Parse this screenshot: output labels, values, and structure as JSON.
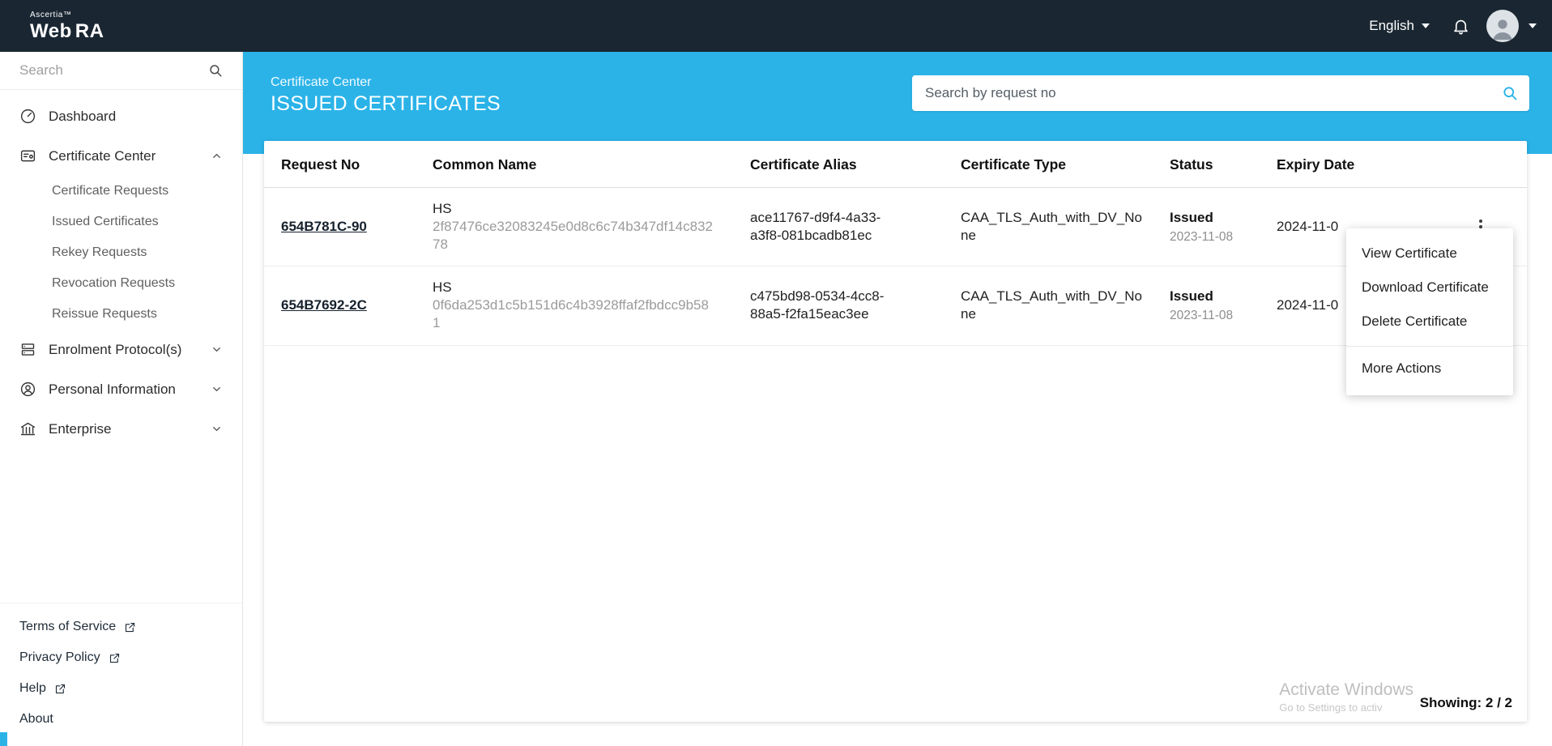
{
  "topbar": {
    "brand_small": "Ascertia™",
    "brand_web": "Web",
    "brand_ra": "RA",
    "language_label": "English",
    "icons": [
      "caret-down-icon",
      "bell-icon",
      "avatar",
      "caret-down-icon"
    ]
  },
  "sidebar": {
    "search_placeholder": "Search",
    "search_icon": "search-icon",
    "items": [
      {
        "label": "Dashboard",
        "icon": "dashboard-icon",
        "expandable": false
      },
      {
        "label": "Certificate Center",
        "icon": "certificate-center-icon",
        "expandable": true,
        "expanded": true,
        "children": [
          {
            "label": "Certificate Requests"
          },
          {
            "label": "Issued Certificates"
          },
          {
            "label": "Rekey Requests"
          },
          {
            "label": "Revocation Requests"
          },
          {
            "label": "Reissue Requests"
          }
        ]
      },
      {
        "label": "Enrolment Protocol(s)",
        "icon": "enrolment-protocols-icon",
        "expandable": true,
        "expanded": false
      },
      {
        "label": "Personal Information",
        "icon": "personal-information-icon",
        "expandable": true,
        "expanded": false
      },
      {
        "label": "Enterprise",
        "icon": "enterprise-icon",
        "expandable": true,
        "expanded": false
      }
    ],
    "footer_links": [
      {
        "label": "Terms of Service",
        "icon": "external-link-icon"
      },
      {
        "label": "Privacy Policy",
        "icon": "external-link-icon"
      },
      {
        "label": "Help",
        "icon": "external-link-icon"
      },
      {
        "label": "About",
        "icon": ""
      }
    ]
  },
  "header": {
    "breadcrumb": "Certificate Center",
    "title": "ISSUED CERTIFICATES",
    "search_placeholder": "Search by request no",
    "search_icon": "search-icon"
  },
  "table": {
    "columns": [
      "Request No",
      "Common Name",
      "Certificate Alias",
      "Certificate Type",
      "Status",
      "Expiry Date"
    ],
    "rows": [
      {
        "request_no": "654B781C-90",
        "common_name_prefix": "HS",
        "common_name_hash": "2f87476ce32083245e0d8c6c74b347df14c83278",
        "certificate_alias": "ace11767-d9f4-4a33-a3f8-081bcadb81ec",
        "certificate_type": "CAA_TLS_Auth_with_DV_None",
        "status": "Issued",
        "status_date": "2023-11-08",
        "expiry_date": "2024-11-0"
      },
      {
        "request_no": "654B7692-2C",
        "common_name_prefix": "HS",
        "common_name_hash": "0f6da253d1c5b151d6c4b3928ffaf2fbdcc9b581",
        "certificate_alias": "c475bd98-0534-4cc8-88a5-f2fa15eac3ee",
        "certificate_type": "CAA_TLS_Auth_with_DV_None",
        "status": "Issued",
        "status_date": "2023-11-08",
        "expiry_date": "2024-11-0"
      }
    ],
    "showing": "Showing: 2 / 2"
  },
  "context_menu": {
    "items": [
      "View Certificate",
      "Download Certificate",
      "Delete Certificate"
    ],
    "more_label": "More Actions"
  },
  "watermark": {
    "line1": "Activate Windows",
    "line2": "Go to Settings to activ"
  },
  "colors": {
    "accent_cyan": "#2bb3e8",
    "topbar_dark": "#1a2732",
    "link_dark": "#16212c"
  }
}
